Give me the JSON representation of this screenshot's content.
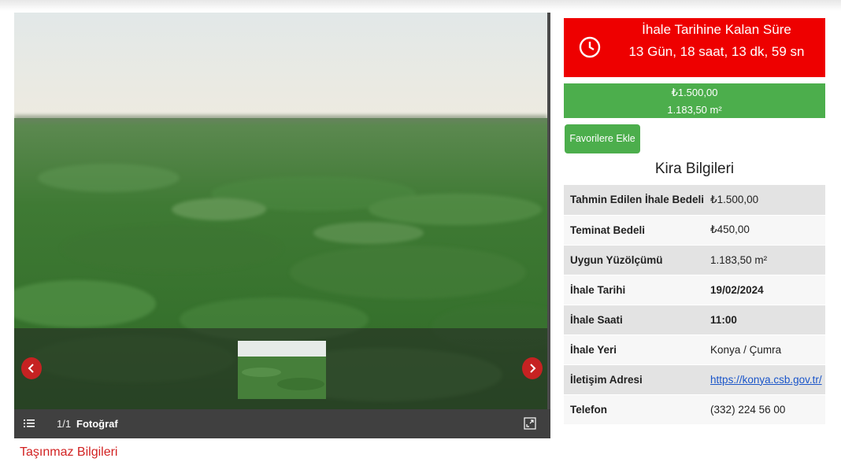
{
  "countdown": {
    "title": "İhale Tarihine Kalan Süre",
    "time": "13 Gün, 18 saat, 13 dk, 59 sn"
  },
  "price_box": {
    "price": "₺1.500,00",
    "area": "1.183,50 m²"
  },
  "favorite_button": "Favorilere Ekle",
  "section_title": "Kira Bilgileri",
  "info_rows": [
    {
      "label": "Tahmin Edilen İhale Bedeli",
      "value": "₺1.500,00"
    },
    {
      "label": "Teminat Bedeli",
      "value": "₺450,00"
    },
    {
      "label": "Uygun Yüzölçümü",
      "value": "1.183,50 m²"
    },
    {
      "label": "İhale Tarihi",
      "value": "19/02/2024"
    },
    {
      "label": "İhale Saati",
      "value": "11:00"
    },
    {
      "label": "İhale Yeri",
      "value": "Konya / Çumra"
    },
    {
      "label": "İletişim Adresi",
      "value": "https://konya.csb.gov.tr/"
    },
    {
      "label": "Telefon",
      "value": "(332) 224 56 00"
    }
  ],
  "gallery": {
    "counter": "1/1",
    "label": "Fotoğraf",
    "prev_icon": "chevron-left-icon",
    "next_icon": "chevron-right-icon"
  },
  "property_link": "Taşınmaz Bilgileri",
  "colors": {
    "countdown_bg": "#ee0000",
    "green": "#4cae4c",
    "nav_red": "#c62222",
    "link_red": "#d22222",
    "link_blue": "#1a55c9"
  }
}
